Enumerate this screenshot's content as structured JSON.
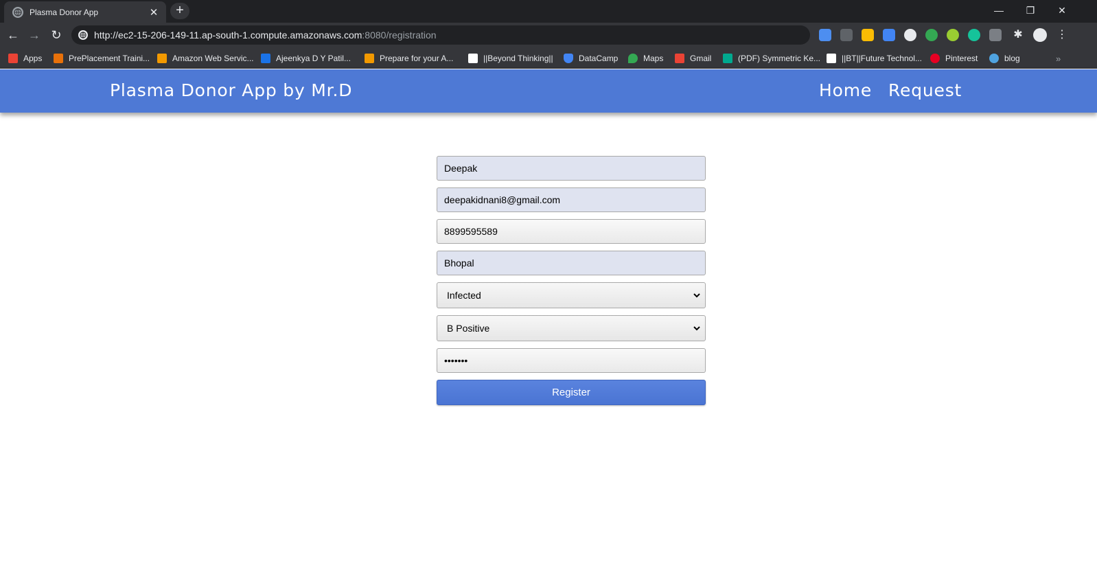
{
  "browser": {
    "tab_title": "Plasma Donor App",
    "url_main": "http://ec2-15-206-149-11.ap-south-1.compute.amazonaws.com",
    "url_rest": ":8080/registration",
    "bookmarks": [
      {
        "label": "Apps",
        "color": "#ea4335"
      },
      {
        "label": "PrePlacement Traini...",
        "color": "#e8710a"
      },
      {
        "label": "Amazon Web Servic...",
        "color": "#f29900"
      },
      {
        "label": "Ajeenkya D Y Patil...",
        "color": "#1a73e8"
      },
      {
        "label": "Prepare for your A...",
        "color": "#f29900"
      },
      {
        "label": "||Beyond Thinking||",
        "color": "#ffffff"
      },
      {
        "label": "DataCamp",
        "color": "#4285f4"
      },
      {
        "label": "Maps",
        "color": "#34a853"
      },
      {
        "label": "Gmail",
        "color": "#ea4335"
      },
      {
        "label": "(PDF) Symmetric Ke...",
        "color": "#00a98f"
      },
      {
        "label": "||BT||Future Technol...",
        "color": "#ffffff"
      },
      {
        "label": "Pinterest",
        "color": "#e60023"
      },
      {
        "label": "blog",
        "color": "#4fa3e0"
      }
    ]
  },
  "app": {
    "brand": "Plasma Donor App by Mr.D",
    "nav": {
      "home": "Home",
      "request": "Request"
    }
  },
  "form": {
    "name": "Deepak",
    "email": "deepakidnani8@gmail.com",
    "phone": "8899595589",
    "city": "Bhopal",
    "status": "Infected",
    "blood_group": "B Positive",
    "password_mask": "•••••••",
    "register_label": "Register"
  }
}
